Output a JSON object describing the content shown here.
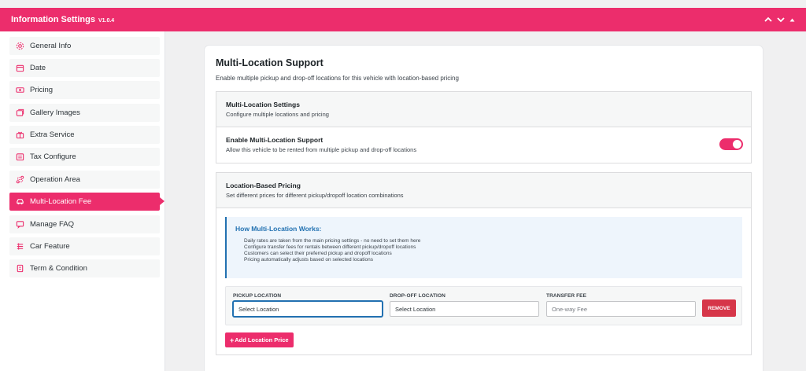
{
  "header": {
    "title": "Information Settings",
    "version": "V1.0.4",
    "accent": "#ec2d6c"
  },
  "sidebar": {
    "active_index": 7,
    "items": [
      {
        "label": "General Info",
        "icon": "gear-icon"
      },
      {
        "label": "Date",
        "icon": "calendar-icon"
      },
      {
        "label": "Pricing",
        "icon": "money-icon"
      },
      {
        "label": "Gallery Images",
        "icon": "images-icon"
      },
      {
        "label": "Extra Service",
        "icon": "gift-icon"
      },
      {
        "label": "Tax Configure",
        "icon": "receipt-icon"
      },
      {
        "label": "Operation Area",
        "icon": "route-icon"
      },
      {
        "label": "Multi-Location Fee",
        "icon": "car-icon"
      },
      {
        "label": "Manage FAQ",
        "icon": "faq-icon"
      },
      {
        "label": "Car Feature",
        "icon": "list-icon"
      },
      {
        "label": "Term & Condition",
        "icon": "document-icon"
      }
    ]
  },
  "main": {
    "title": "Multi-Location Support",
    "description": "Enable multiple pickup and drop-off locations for this vehicle with location-based pricing",
    "settings_panel": {
      "title": "Multi-Location Settings",
      "subtitle": "Configure multiple locations and pricing",
      "enable_row": {
        "title": "Enable Multi-Location Support",
        "subtitle": "Allow this vehicle to be rented from multiple pickup and drop-off locations",
        "enabled": true
      }
    },
    "pricing_panel": {
      "title": "Location-Based Pricing",
      "subtitle": "Set different prices for different pickup/dropoff location combinations",
      "info": {
        "title": "How Multi-Location Works:",
        "lines": [
          "Daily rates are taken from the main pricing settings - no need to set them here",
          "Configure transfer fees for rentals between different pickup/dropoff locations",
          "Customers can select their preferred pickup and dropoff locations",
          "Pricing automatically adjusts based on selected locations"
        ]
      },
      "row": {
        "pickup_label": "PICKUP LOCATION",
        "pickup_value": "Select Location",
        "dropoff_label": "DROP-OFF LOCATION",
        "dropoff_value": "Select Location",
        "fee_label": "TRANSFER FEE",
        "fee_placeholder": "One-way Fee",
        "remove_label": "REMOVE"
      },
      "add_label": "Add Location Price"
    }
  }
}
